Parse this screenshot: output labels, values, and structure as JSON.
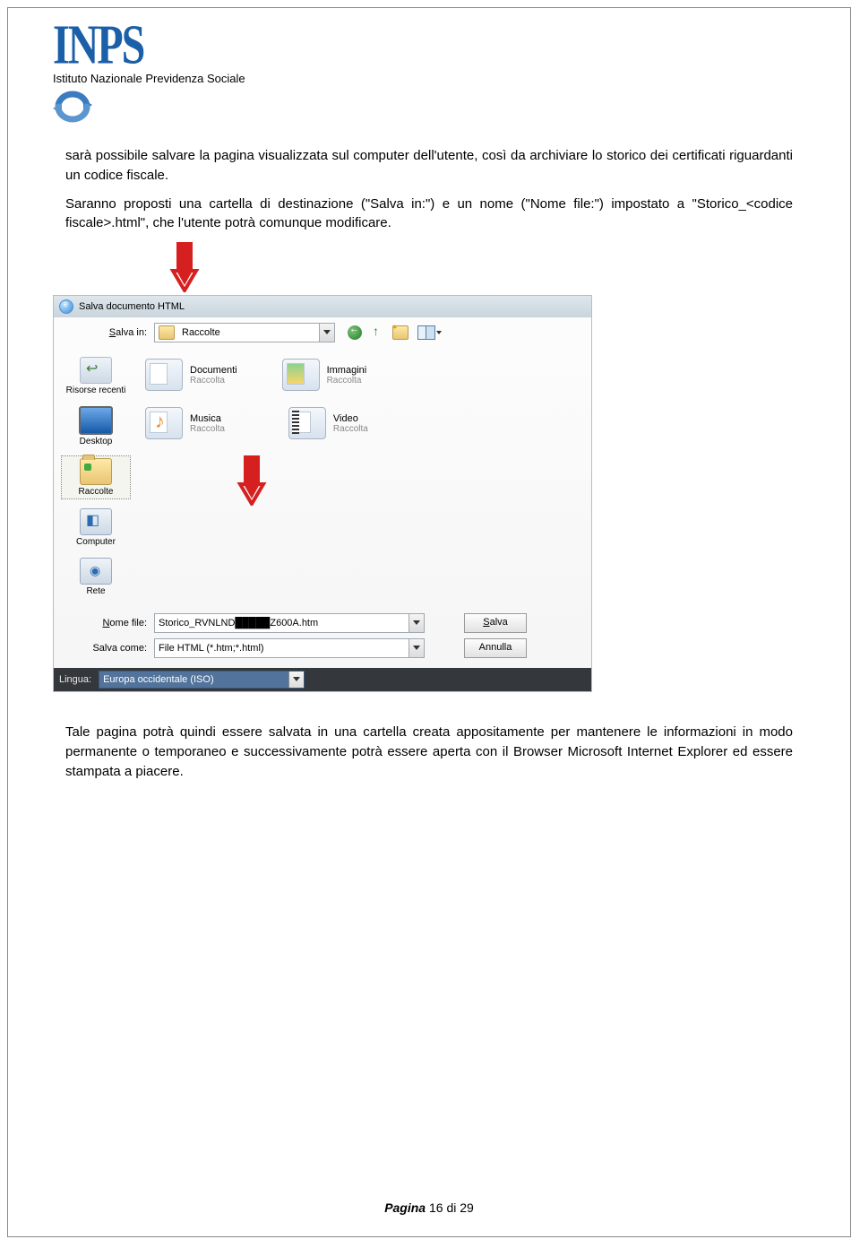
{
  "header": {
    "logo_text": "INPS",
    "org_name": "Istituto Nazionale Previdenza Sociale"
  },
  "paragraph1": "sarà possibile salvare la pagina visualizzata sul computer dell'utente, così da archiviare lo storico dei certificati riguardanti un codice fiscale.",
  "paragraph2": "Saranno proposti una cartella di destinazione (\"Salva in:\") e un nome (\"Nome file:\") impostato a \"Storico_<codice fiscale>.html\", che l'utente potrà comunque modificare.",
  "dialog": {
    "title": "Salva documento HTML",
    "save_in_label": "Salva in:",
    "save_in_value": "Raccolte",
    "sidebar": {
      "recent": "Risorse recenti",
      "desktop": "Desktop",
      "libraries": "Raccolte",
      "computer": "Computer",
      "network": "Rete"
    },
    "files": {
      "documents_title": "Documenti",
      "documents_sub": "Raccolta",
      "images_title": "Immagini",
      "images_sub": "Raccolta",
      "music_title": "Musica",
      "music_sub": "Raccolta",
      "video_title": "Video",
      "video_sub": "Raccolta"
    },
    "name_label": "Nome file:",
    "name_value": "Storico_RVNLND█████Z600A.htm",
    "type_label": "Salva come:",
    "type_value": "File HTML (*.htm;*.html)",
    "save_btn": "Salva",
    "cancel_btn": "Annulla",
    "language_label": "Lingua:",
    "language_value": "Europa occidentale (ISO)"
  },
  "paragraph3": "Tale pagina potrà quindi essere salvata in una cartella creata appositamente per mantenere le informazioni in modo permanente o temporaneo e successivamente potrà essere aperta con il Browser Microsoft Internet Explorer ed essere stampata a piacere.",
  "footer": {
    "label": "Pagina",
    "value": "16 di 29"
  }
}
